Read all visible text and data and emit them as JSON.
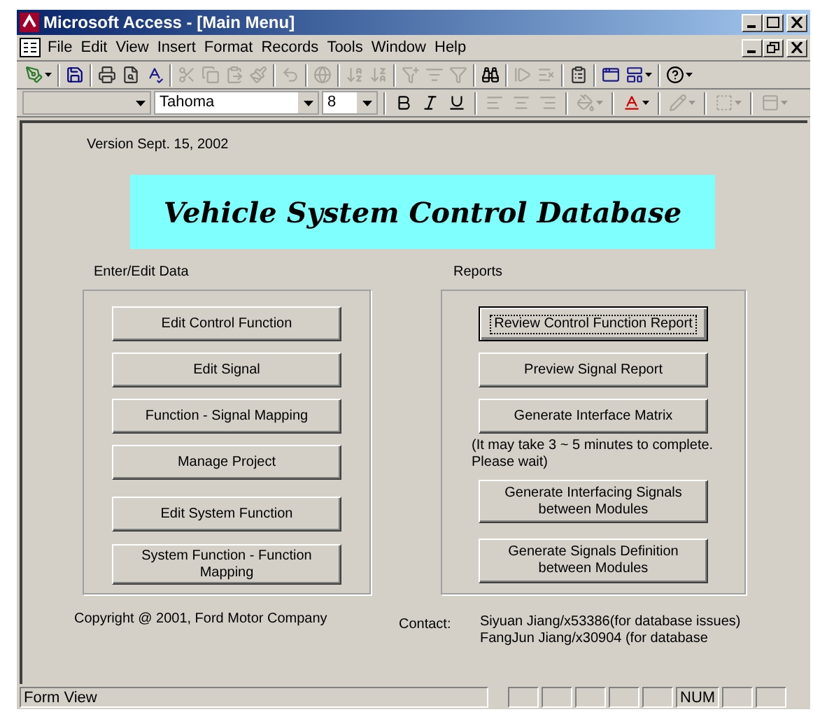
{
  "window": {
    "title": "Microsoft Access - [Main Menu]"
  },
  "menu": [
    {
      "label": "File"
    },
    {
      "label": "Edit"
    },
    {
      "label": "View"
    },
    {
      "label": "Insert"
    },
    {
      "label": "Format"
    },
    {
      "label": "Records"
    },
    {
      "label": "Tools"
    },
    {
      "label": "Window"
    },
    {
      "label": "Help"
    }
  ],
  "toolbar": [
    [
      {
        "kind": "design",
        "disabled": false,
        "dropdown": true
      }
    ],
    [
      {
        "kind": "save",
        "disabled": false
      }
    ],
    [
      {
        "kind": "print",
        "disabled": false
      },
      {
        "kind": "preview",
        "disabled": false
      },
      {
        "kind": "spelling",
        "disabled": false
      }
    ],
    [
      {
        "kind": "cut",
        "disabled": true
      },
      {
        "kind": "copy",
        "disabled": true
      },
      {
        "kind": "paste",
        "disabled": true
      },
      {
        "kind": "painter",
        "disabled": true
      }
    ],
    [
      {
        "kind": "undo",
        "disabled": true
      }
    ],
    [
      {
        "kind": "hyperlink",
        "disabled": true
      }
    ],
    [
      {
        "kind": "sort-asc",
        "disabled": true
      },
      {
        "kind": "sort-desc",
        "disabled": true
      }
    ],
    [
      {
        "kind": "filter-selection",
        "disabled": true
      },
      {
        "kind": "filter-form",
        "disabled": true
      },
      {
        "kind": "filter",
        "disabled": true
      }
    ],
    [
      {
        "kind": "find",
        "disabled": false
      }
    ],
    [
      {
        "kind": "new-record",
        "disabled": true
      },
      {
        "kind": "delete-record",
        "disabled": true
      }
    ],
    [
      {
        "kind": "properties",
        "disabled": false
      }
    ],
    [
      {
        "kind": "database",
        "disabled": false
      },
      {
        "kind": "new-object",
        "disabled": false,
        "dropdown": true
      }
    ],
    [
      {
        "kind": "help",
        "disabled": false,
        "dropdown": true
      }
    ]
  ],
  "format_toolbar": {
    "font": {
      "value": "Tahoma"
    },
    "size": {
      "value": "8"
    },
    "tools": [
      [
        {
          "kind": "bold",
          "disabled": false
        },
        {
          "kind": "italic",
          "disabled": false
        },
        {
          "kind": "underline",
          "disabled": false
        }
      ],
      [
        {
          "kind": "align-left",
          "disabled": true
        },
        {
          "kind": "align-center",
          "disabled": true
        },
        {
          "kind": "align-right",
          "disabled": true
        }
      ],
      [
        {
          "kind": "fill-color",
          "disabled": true,
          "dropdown": true
        }
      ],
      [
        {
          "kind": "font-color",
          "disabled": false,
          "dropdown": true
        }
      ],
      [
        {
          "kind": "line-color",
          "disabled": true,
          "dropdown": true
        }
      ],
      [
        {
          "kind": "border",
          "disabled": true,
          "dropdown": true
        }
      ],
      [
        {
          "kind": "effect",
          "disabled": true,
          "dropdown": true
        }
      ]
    ]
  },
  "form": {
    "version": "Version Sept. 15, 2002",
    "banner": "Vehicle System Control Database",
    "edit_section": {
      "heading": "Enter/Edit Data",
      "buttons": [
        {
          "label": "Edit Control Function",
          "focused": false
        },
        {
          "label": "Edit Signal",
          "focused": false
        },
        {
          "label": "Function - Signal Mapping",
          "focused": false
        },
        {
          "label": "Manage Project",
          "focused": false
        },
        {
          "label": "Edit System Function",
          "focused": false
        },
        {
          "label": "System Function - Function Mapping",
          "focused": false
        }
      ]
    },
    "reports_section": {
      "heading": "Reports",
      "buttons": [
        {
          "label": "Review Control Function Report",
          "focused": true
        },
        {
          "label": "Preview Signal Report",
          "focused": false
        },
        {
          "label": "Generate Interface Matrix",
          "focused": false,
          "note": "(It may take 3 ~ 5 minutes to complete. Please wait)"
        },
        {
          "label": "Generate Interfacing Signals between Modules",
          "focused": false
        },
        {
          "label": "Generate Signals Definition between Modules",
          "focused": false
        }
      ]
    },
    "copyright": "Copyright @ 2001, Ford Motor Company",
    "contact": {
      "label": "Contact:",
      "lines": [
        "Siyuan Jiang/x53386(for database issues)",
        "FangJun Jiang/x30904 (for database"
      ]
    }
  },
  "status_bar": {
    "message": "Form View",
    "indicators": [
      {
        "label": "NUM"
      }
    ]
  }
}
